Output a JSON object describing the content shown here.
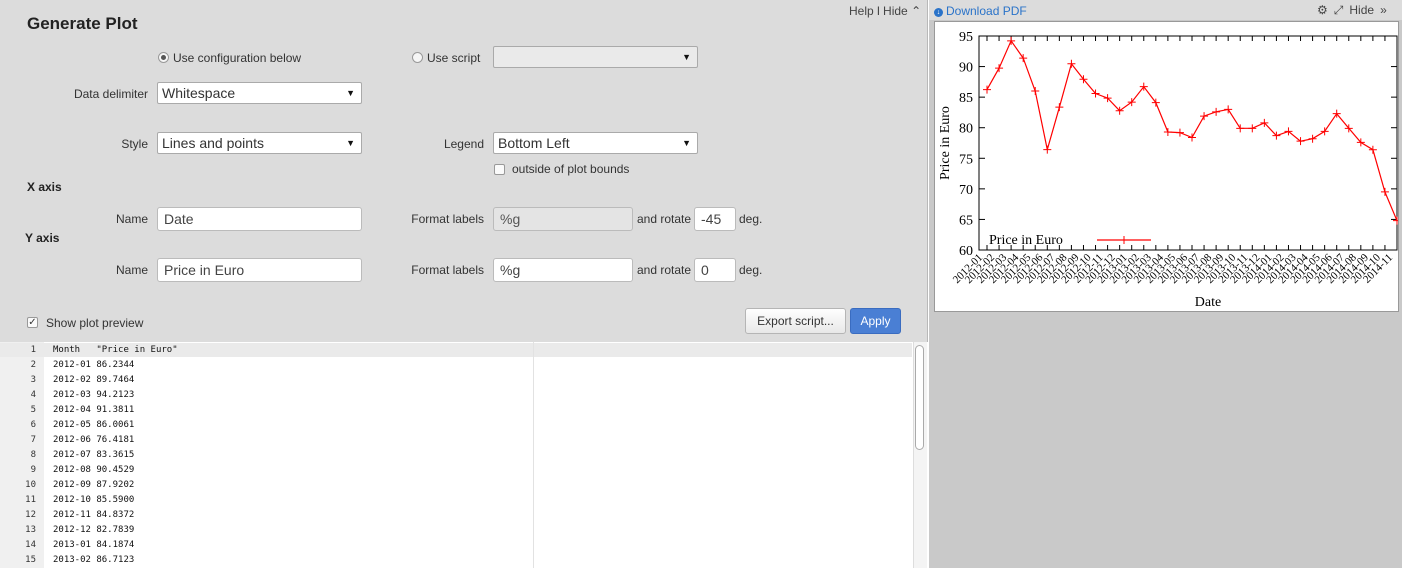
{
  "form": {
    "title": "Generate Plot",
    "help": "Help",
    "hide": "Hide",
    "hide_icon": "chevron-up-double-icon",
    "source": {
      "config_label": "Use configuration below",
      "script_label": "Use script",
      "script_value": ""
    },
    "delimiter": {
      "label": "Data delimiter",
      "value": "Whitespace"
    },
    "style": {
      "label": "Style",
      "value": "Lines and points"
    },
    "legend": {
      "label": "Legend",
      "value": "Bottom Left",
      "outside_label": "outside of plot bounds"
    },
    "x_axis": {
      "heading": "X axis",
      "name_label": "Name",
      "name_value": "Date",
      "format_label": "Format labels",
      "format_value": "%g",
      "rotate_label": "and rotate",
      "rotate_value": "-45",
      "deg_label": "deg."
    },
    "y_axis": {
      "heading": "Y axis",
      "name_label": "Name",
      "name_value": "Price in Euro",
      "format_label": "Format labels",
      "format_value": "%g",
      "rotate_label": "and rotate",
      "rotate_value": "0",
      "deg_label": "deg."
    },
    "preview_label": "Show plot preview",
    "export_label": "Export script...",
    "apply_label": "Apply"
  },
  "editor": {
    "lines": [
      {
        "n": "1",
        "text": "Month   \"Price in Euro\""
      },
      {
        "n": "2",
        "text": "2012-01 86.2344"
      },
      {
        "n": "3",
        "text": "2012-02 89.7464"
      },
      {
        "n": "4",
        "text": "2012-03 94.2123"
      },
      {
        "n": "5",
        "text": "2012-04 91.3811"
      },
      {
        "n": "6",
        "text": "2012-05 86.0061"
      },
      {
        "n": "7",
        "text": "2012-06 76.4181"
      },
      {
        "n": "8",
        "text": "2012-07 83.3615"
      },
      {
        "n": "9",
        "text": "2012-08 90.4529"
      },
      {
        "n": "10",
        "text": "2012-09 87.9202"
      },
      {
        "n": "11",
        "text": "2012-10 85.5900"
      },
      {
        "n": "12",
        "text": "2012-11 84.8372"
      },
      {
        "n": "13",
        "text": "2012-12 82.7839"
      },
      {
        "n": "14",
        "text": "2013-01 84.1874"
      },
      {
        "n": "15",
        "text": "2013-02 86.7123"
      }
    ]
  },
  "preview": {
    "download_label": "Download PDF",
    "download_icon": "download-circle-icon",
    "gear_icon": "gear-icon",
    "expand_icon": "expand-icon",
    "hide_label": "Hide",
    "hide_icon": "chevron-right-double-icon"
  },
  "chart_data": {
    "type": "line",
    "xlabel": "Date",
    "ylabel": "Price in Euro",
    "ylim": [
      60,
      95
    ],
    "yticks": [
      60,
      65,
      70,
      75,
      80,
      85,
      90,
      95
    ],
    "legend": "bottom-left",
    "grid": false,
    "series": [
      {
        "name": "Price in Euro",
        "color": "#ff0000",
        "marker": "plus",
        "values": [
          86.2344,
          89.7464,
          94.2123,
          91.3811,
          86.0061,
          76.4181,
          83.3615,
          90.4529,
          87.9202,
          85.59,
          84.8372,
          82.7839,
          84.1874,
          86.7123,
          84.1,
          79.3,
          79.2,
          78.4,
          81.9,
          82.6,
          83.0,
          79.9,
          79.9,
          80.8,
          78.7,
          79.4,
          77.8,
          78.2,
          79.4,
          82.3,
          79.9,
          77.6,
          76.4,
          69.5,
          64.8
        ]
      }
    ],
    "x": [
      "2012-01",
      "2012-02",
      "2012-03",
      "2012-04",
      "2012-05",
      "2012-06",
      "2012-07",
      "2012-08",
      "2012-09",
      "2012-10",
      "2012-11",
      "2012-12",
      "2013-01",
      "2013-02",
      "2013-03",
      "2013-04",
      "2013-05",
      "2013-06",
      "2013-07",
      "2013-08",
      "2013-09",
      "2013-10",
      "2013-11",
      "2013-12",
      "2014-01",
      "2014-02",
      "2014-03",
      "2014-04",
      "2014-05",
      "2014-06",
      "2014-07",
      "2014-08",
      "2014-09",
      "2014-10",
      "2014-11"
    ]
  }
}
